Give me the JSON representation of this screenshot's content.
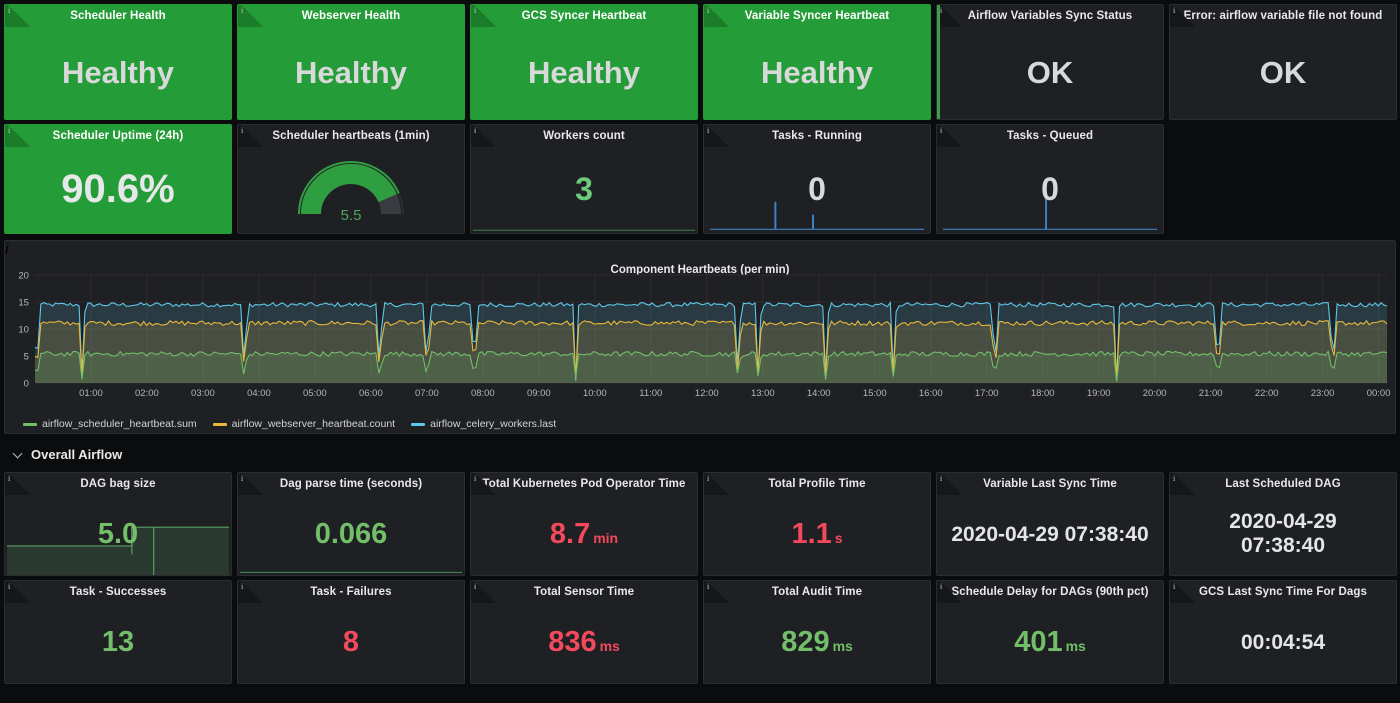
{
  "dashboard": {
    "row_header": {
      "label": "Overall Airflow",
      "icon": "chevron-down-icon"
    },
    "info_icon": "info-icon"
  },
  "status_panels": [
    {
      "title": "Scheduler Health",
      "value": "Healthy",
      "style": "green"
    },
    {
      "title": "Webserver Health",
      "value": "Healthy",
      "style": "green"
    },
    {
      "title": "GCS Syncer Heartbeat",
      "value": "Healthy",
      "style": "green"
    },
    {
      "title": "Variable Syncer Heartbeat",
      "value": "Healthy",
      "style": "green"
    },
    {
      "title": "Airflow Variables Sync Status",
      "value": "OK",
      "style": "dark-green-stripe"
    },
    {
      "title": "Error: airflow variable file not found",
      "value": "OK",
      "style": "dark"
    }
  ],
  "metric_panels": [
    {
      "title": "Scheduler Uptime (24h)",
      "value": "90.6%",
      "style": "green"
    },
    {
      "title": "Scheduler heartbeats (1min)",
      "value": "5.5",
      "style": "gauge"
    },
    {
      "title": "Workers count",
      "value": "3",
      "style": "green-text"
    },
    {
      "title": "Tasks - Running",
      "value": "0",
      "style": "white-text"
    },
    {
      "title": "Tasks - Queued",
      "value": "0",
      "style": "white-text"
    }
  ],
  "overall_airflow_row1": [
    {
      "title": "DAG bag size",
      "value": "5.0",
      "unit": "",
      "color": "green"
    },
    {
      "title": "Dag parse time (seconds)",
      "value": "0.066",
      "unit": "",
      "color": "green"
    },
    {
      "title": "Total Kubernetes Pod Operator Time",
      "value": "8.7",
      "unit": "min",
      "color": "red"
    },
    {
      "title": "Total Profile Time",
      "value": "1.1",
      "unit": "s",
      "color": "red"
    },
    {
      "title": "Variable Last Sync Time",
      "value": "2020-04-29 07:38:40",
      "unit": "",
      "color": "white"
    },
    {
      "title": "Last Scheduled DAG",
      "value": "2020-04-29\n07:38:40",
      "unit": "",
      "color": "white"
    }
  ],
  "overall_airflow_row2": [
    {
      "title": "Task - Successes",
      "value": "13",
      "unit": "",
      "color": "green"
    },
    {
      "title": "Task - Failures",
      "value": "8",
      "unit": "",
      "color": "red"
    },
    {
      "title": "Total Sensor Time",
      "value": "836",
      "unit": "ms",
      "color": "red"
    },
    {
      "title": "Total Audit Time",
      "value": "829",
      "unit": "ms",
      "color": "green"
    },
    {
      "title": "Schedule Delay for DAGs (90th pct)",
      "value": "401",
      "unit": "ms",
      "color": "green"
    },
    {
      "title": "GCS Last Sync Time For Dags",
      "value": "00:04:54",
      "unit": "",
      "color": "white"
    }
  ],
  "chart_data": {
    "type": "area",
    "title": "Component Heartbeats (per min)",
    "xlabel": "",
    "ylabel": "",
    "ylim": [
      0,
      20
    ],
    "yticks": [
      0,
      5,
      10,
      15,
      20
    ],
    "grid": true,
    "legend_position": "bottom",
    "xticks": [
      "01:00",
      "02:00",
      "03:00",
      "04:00",
      "05:00",
      "06:00",
      "07:00",
      "08:00",
      "09:00",
      "10:00",
      "11:00",
      "12:00",
      "13:00",
      "14:00",
      "15:00",
      "16:00",
      "17:00",
      "18:00",
      "19:00",
      "20:00",
      "21:00",
      "22:00",
      "23:00",
      "00:00"
    ],
    "series": [
      {
        "name": "airflow_scheduler_heartbeat.sum",
        "color": "#73bf69",
        "baseline": 5.4,
        "jitter": 0.45,
        "dips": [
          0.035,
          0.155,
          0.255,
          0.29,
          0.325,
          0.4,
          0.52,
          0.535,
          0.585,
          0.635,
          0.71,
          0.8,
          0.875,
          0.96
        ]
      },
      {
        "name": "airflow_webserver_heartbeat.count",
        "color": "#eab839",
        "baseline": 11.1,
        "jitter": 0.45,
        "dips": [
          0.035,
          0.155,
          0.255,
          0.29,
          0.325,
          0.4,
          0.52,
          0.535,
          0.585,
          0.635,
          0.71,
          0.8,
          0.875,
          0.96
        ]
      },
      {
        "name": "airflow_celery_workers.last",
        "color": "#5dc8e8",
        "baseline": 14.5,
        "jitter": 0.4,
        "dips": [
          0.035,
          0.155,
          0.255,
          0.29,
          0.325,
          0.4,
          0.52,
          0.535,
          0.585,
          0.635,
          0.71,
          0.8,
          0.875,
          0.96
        ]
      }
    ]
  },
  "colors": {
    "green_panel": "#249c37",
    "green_text": "#73bf69",
    "red_text": "#f2495c",
    "white_text": "#e4e5e6",
    "blue_spark": "#3b82c4",
    "panel_bg": "#1f2024",
    "page_bg": "#0b0c0e"
  }
}
